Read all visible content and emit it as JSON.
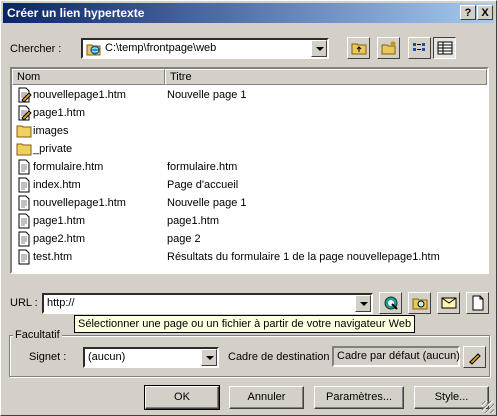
{
  "dialog": {
    "title": "Créer un lien hypertexte",
    "help_label": "?",
    "close_label": "X"
  },
  "lookin": {
    "label": "Chercher :",
    "value": "C:\\temp\\frontpage\\web"
  },
  "list": {
    "headers": {
      "name": "Nom",
      "title": "Titre"
    },
    "rows": [
      {
        "name": "nouvellepage1.htm",
        "title": "Nouvelle page 1",
        "icon": "edited-page-icon"
      },
      {
        "name": "page1.htm",
        "title": "",
        "icon": "edited-page-icon"
      },
      {
        "name": "images",
        "title": "",
        "icon": "folder-icon"
      },
      {
        "name": "_private",
        "title": "",
        "icon": "folder-icon"
      },
      {
        "name": "formulaire.htm",
        "title": "formulaire.htm",
        "icon": "page-icon"
      },
      {
        "name": "index.htm",
        "title": "Page d'accueil",
        "icon": "page-icon"
      },
      {
        "name": "nouvellepage1.htm",
        "title": "Nouvelle page 1",
        "icon": "page-icon"
      },
      {
        "name": "page1.htm",
        "title": "page1.htm",
        "icon": "page-icon"
      },
      {
        "name": "page2.htm",
        "title": "page 2",
        "icon": "page-icon"
      },
      {
        "name": "test.htm",
        "title": "Résultats du formulaire 1 de la page nouvellepage1.htm",
        "icon": "page-icon"
      }
    ]
  },
  "url": {
    "label": "URL :",
    "value": "http://"
  },
  "tooltip": "Sélectionner une page ou un fichier à partir de votre navigateur Web",
  "optional": {
    "group_label": "Facultatif",
    "bookmark_label": "Signet :",
    "bookmark_value": "(aucun)",
    "target_label": "Cadre de destination :",
    "target_value": "Cadre par défaut (aucun)"
  },
  "buttons": {
    "ok": "OK",
    "cancel": "Annuler",
    "params": "Paramètres...",
    "style": "Style..."
  },
  "colors": {
    "titlebar_start": "#0a246a",
    "titlebar_end": "#a6caf0",
    "face": "#d4d0c8",
    "tooltip_bg": "#ffffe1"
  }
}
